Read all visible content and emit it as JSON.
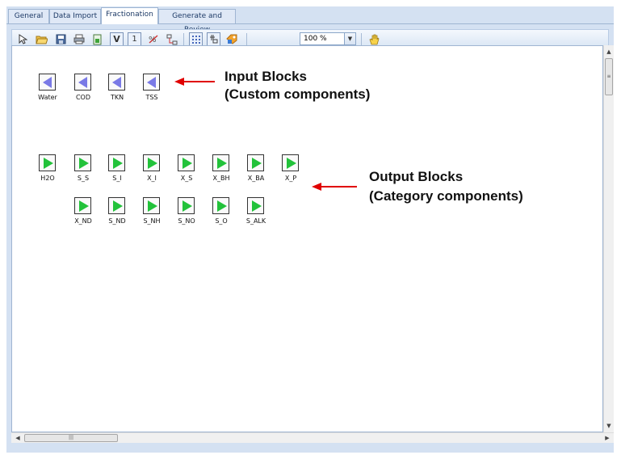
{
  "tabs": [
    "General",
    "Data Import",
    "Fractionation",
    "Generate and Review"
  ],
  "active_tab": "Fractionation",
  "toolbar": {
    "zoom_value": "100 %",
    "icons": [
      "pointer-icon",
      "open-folder-icon",
      "save-icon",
      "print-icon",
      "export-icon",
      "v-icon",
      "one-icon",
      "formula-icon",
      "connect-icon",
      "grid-icon",
      "snap-icon",
      "tag-icon",
      "hand-icon"
    ]
  },
  "input_blocks": [
    "Water",
    "COD",
    "TKN",
    "TSS"
  ],
  "output_blocks_row1": [
    "H2O",
    "S_S",
    "S_I",
    "X_I",
    "X_S",
    "X_BH",
    "X_BA",
    "X_P"
  ],
  "output_blocks_row2": [
    "X_ND",
    "S_ND",
    "S_NH",
    "S_NO",
    "S_O",
    "S_ALK"
  ],
  "annotations": {
    "input_line1": "Input Blocks",
    "input_line2": "(Custom components)",
    "output_line1": "Output Blocks",
    "output_line2": "(Category components)"
  },
  "colors": {
    "input_triangle": "#7a7ae6",
    "output_triangle": "#22c23a",
    "arrow": "#e00000"
  }
}
